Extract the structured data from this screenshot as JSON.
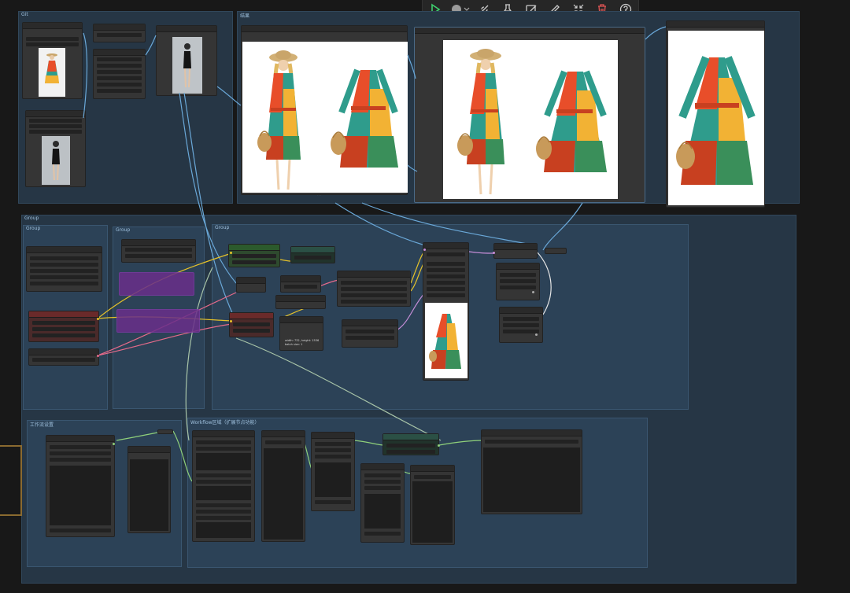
{
  "toolbar": {
    "run": "run-icon",
    "color": "color-picker-icon",
    "bypass": "bypass-icon",
    "pin": "pin-icon",
    "edit": "edit-icon",
    "pencil": "pencil-icon",
    "fit": "fit-view-icon",
    "delete": "delete-icon",
    "help": "help-icon"
  },
  "groups": {
    "top_left": "Git",
    "top_right": "结果",
    "main": "Group",
    "left1": "Group",
    "left2": "Group",
    "center": "Group",
    "bottom_left": "工作流设置",
    "bottom_right": "Workflow区域（扩展节点功能）"
  },
  "info_node": {
    "line1": "width: 732, height: 1536",
    "line2": "batch size: 1"
  },
  "colors": {
    "canvas": "#181818",
    "group": "#263645",
    "wire_yellow": "#e6c229",
    "wire_pink": "#e56a8a",
    "wire_blue": "#6aa8d8",
    "wire_green": "#8fd07a",
    "wire_lilac": "#c78ed8",
    "delete": "#e05555"
  }
}
